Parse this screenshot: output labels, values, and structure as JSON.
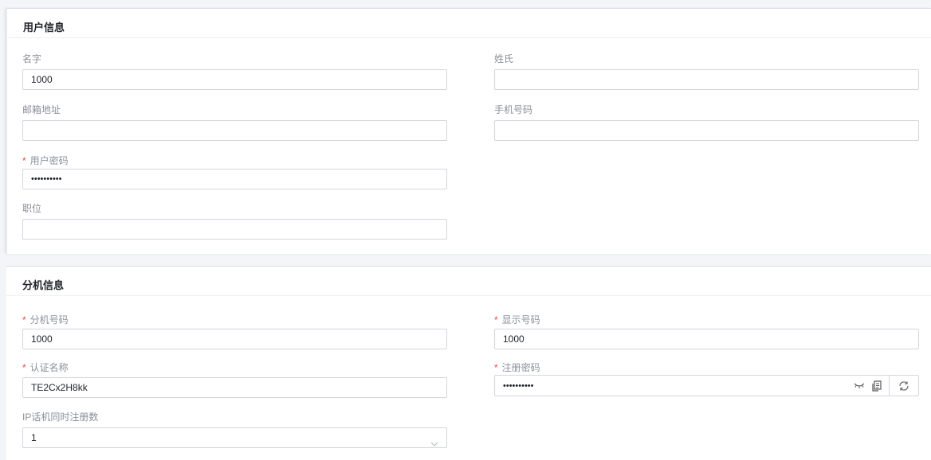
{
  "user_info": {
    "title": "用户信息",
    "first_name": {
      "label": "名字",
      "value": "1000"
    },
    "last_name": {
      "label": "姓氏",
      "value": ""
    },
    "email": {
      "label": "邮箱地址",
      "value": ""
    },
    "mobile": {
      "label": "手机号码",
      "value": ""
    },
    "user_password": {
      "label": "用户密码",
      "required_mark": "*",
      "value": "••••••••••"
    },
    "job_title": {
      "label": "职位",
      "value": ""
    }
  },
  "extension_info": {
    "title": "分机信息",
    "extension_number": {
      "label": "分机号码",
      "required_mark": "*",
      "value": "1000"
    },
    "caller_id": {
      "label": "显示号码",
      "required_mark": "*",
      "value": "1000"
    },
    "auth_name": {
      "label": "认证名称",
      "required_mark": "*",
      "value": "TE2Cx2H8kk"
    },
    "registration_password": {
      "label": "注册密码",
      "required_mark": "*",
      "value": "••••••••••"
    },
    "concurrent_registrations": {
      "label": "IP话机同时注册数",
      "value": "1"
    }
  },
  "icons": [
    "eye-closed-icon",
    "copy-icon",
    "refresh-icon",
    "chevron-down-icon"
  ],
  "colors": {
    "required": "#e8483f",
    "label": "#8a8f99",
    "border": "#d3d7dd"
  }
}
